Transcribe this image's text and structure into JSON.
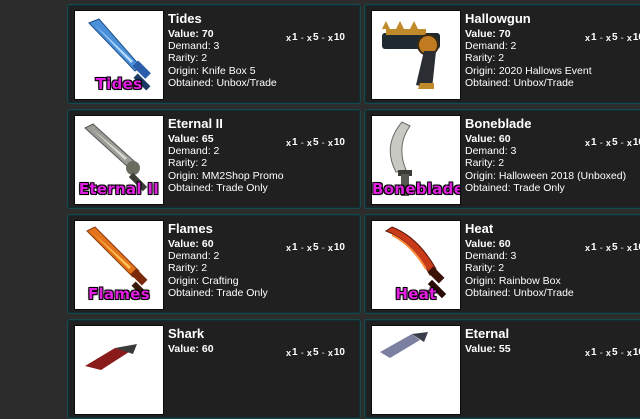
{
  "items": [
    {
      "name": "Tides",
      "image_label": "Tides",
      "value": "Value: 70",
      "demand": "Demand: 3",
      "rarity": "Rarity: 2",
      "origin": "Origin: Knife Box 5",
      "obtained": "Obtained: Unbox/Trade",
      "icon": "knife-icon",
      "blade_color": "#4a8fd8"
    },
    {
      "name": "Hallowgun",
      "image_label": "",
      "value": "Value: 70",
      "demand": "Demand: 2",
      "rarity": "Rarity: 2",
      "origin": "Origin: 2020 Hallows Event",
      "obtained": "Obtained: Unbox/Trade",
      "icon": "gun-icon",
      "blade_color": "#1f2a30"
    },
    {
      "name": "Eternal II",
      "image_label": "Eternal II",
      "value": "Value: 65",
      "demand": "Demand: 2",
      "rarity": "Rarity: 2",
      "origin": "Origin: MM2Shop Promo",
      "obtained": "Obtained: Trade Only",
      "icon": "knife-icon",
      "blade_color": "#9a9c96"
    },
    {
      "name": "Boneblade",
      "image_label": "Boneblade",
      "value": "Value: 60",
      "demand": "Demand: 3",
      "rarity": "Rarity: 2",
      "origin": "Origin: Halloween 2018 (Unboxed)",
      "obtained": "Obtained: Trade Only",
      "icon": "knife-icon",
      "blade_color": "#c9c9c4"
    },
    {
      "name": "Flames",
      "image_label": "Flames",
      "value": "Value: 60",
      "demand": "Demand: 2",
      "rarity": "Rarity: 2",
      "origin": "Origin: Crafting",
      "obtained": "Obtained: Trade Only",
      "icon": "knife-icon",
      "blade_color": "#e2731b"
    },
    {
      "name": "Heat",
      "image_label": "Heat",
      "value": "Value: 60",
      "demand": "Demand: 3",
      "rarity": "Rarity: 2",
      "origin": "Origin: Rainbow Box",
      "obtained": "Obtained: Unbox/Trade",
      "icon": "knife-icon",
      "blade_color": "#c93a1a"
    },
    {
      "name": "Shark",
      "image_label": "",
      "value": "Value: 60",
      "demand": "",
      "rarity": "",
      "origin": "",
      "obtained": "",
      "icon": "knife-icon",
      "blade_color": "#8a1b1b"
    },
    {
      "name": "Eternal",
      "image_label": "",
      "value": "Value: 55",
      "demand": "",
      "rarity": "",
      "origin": "",
      "obtained": "",
      "icon": "knife-icon",
      "blade_color": "#7b7fa0"
    }
  ],
  "multipliers": [
    {
      "x": "x",
      "n": "1"
    },
    {
      "x": "x",
      "n": "5"
    },
    {
      "x": "x",
      "n": "10"
    }
  ],
  "separator": "-"
}
